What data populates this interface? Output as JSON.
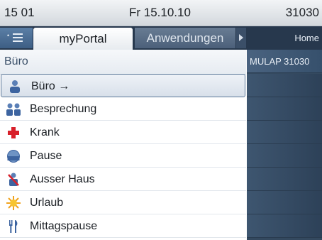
{
  "status": {
    "extension": "15 01",
    "datetime": "Fr 15.10.10",
    "number": "31030"
  },
  "tabs": {
    "active": "myPortal",
    "inactive": "Anwendungen"
  },
  "side": {
    "header": "Home",
    "first_row": "MULAP 31030"
  },
  "panel": {
    "title": "Büro",
    "items": [
      {
        "label": "Büro →",
        "icon": "office-person-icon",
        "selected": true
      },
      {
        "label": "Besprechung",
        "icon": "meeting-people-icon",
        "selected": false
      },
      {
        "label": "Krank",
        "icon": "sick-cross-icon",
        "selected": false
      },
      {
        "label": "Pause",
        "icon": "pause-clock-icon",
        "selected": false
      },
      {
        "label": "Ausser Haus",
        "icon": "out-of-office-icon",
        "selected": false
      },
      {
        "label": "Urlaub",
        "icon": "vacation-sun-icon",
        "selected": false
      },
      {
        "label": "Mittagspause",
        "icon": "lunch-cutlery-icon",
        "selected": false
      }
    ]
  },
  "colors": {
    "accent": "#5c7898",
    "tabbar": "#27384d",
    "sick": "#d8202a"
  }
}
